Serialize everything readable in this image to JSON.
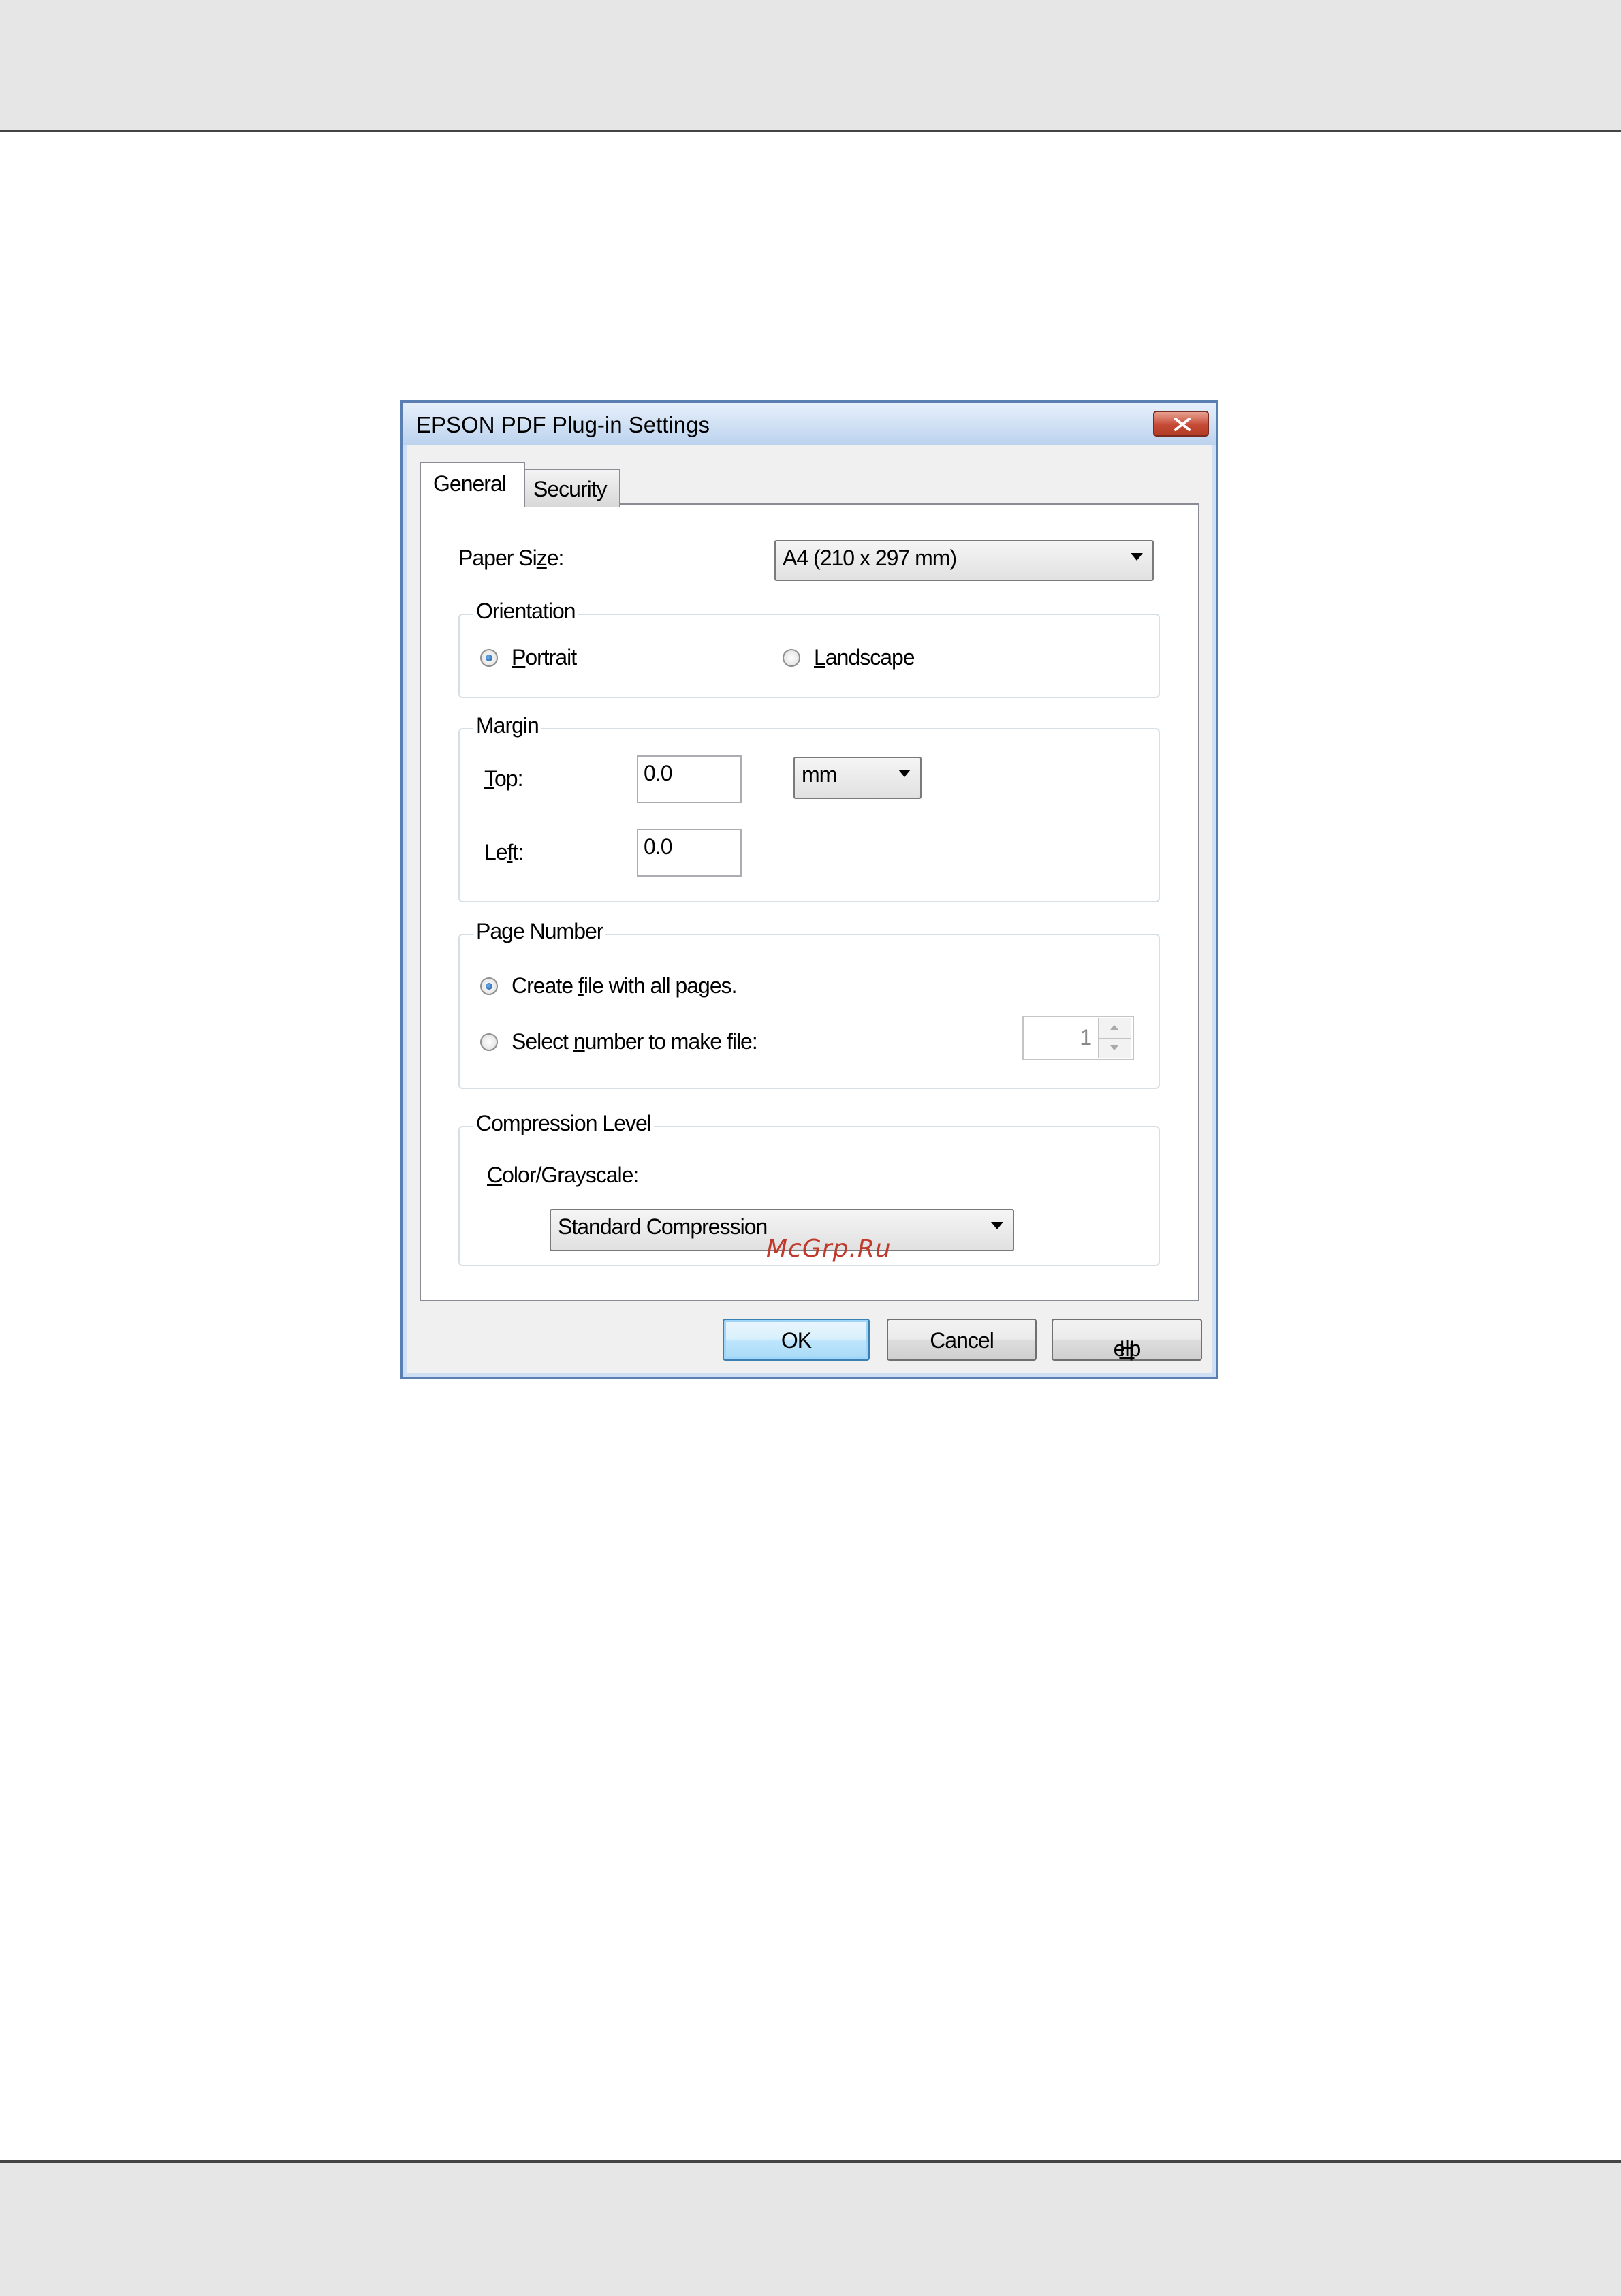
{
  "dialog": {
    "title": "EPSON PDF Plug-in Settings",
    "tabs": [
      {
        "label": "General",
        "selected": true
      },
      {
        "label": "Security",
        "selected": false
      }
    ],
    "paper_size": {
      "label_pre": "Paper Si",
      "label_key": "z",
      "label_post": "e:",
      "value": "A4 (210 x 297 mm)"
    },
    "orientation": {
      "legend": "Orientation",
      "portrait": {
        "key": "P",
        "rest": "ortrait",
        "selected": true
      },
      "landscape": {
        "key": "L",
        "rest": "andscape",
        "selected": false
      }
    },
    "margin": {
      "legend": "Margin",
      "top_label_key": "T",
      "top_label_rest": "op:",
      "top_value": "0.0",
      "left_label_pre": "Le",
      "left_label_key": "f",
      "left_label_post": "t:",
      "left_value": "0.0",
      "unit": "mm"
    },
    "page_number": {
      "legend": "Page Number",
      "all_pages": {
        "pre": "Create ",
        "key": "f",
        "post": "ile with all pages.",
        "selected": true
      },
      "select_number": {
        "pre": "Select ",
        "key": "n",
        "post": "umber to make file:",
        "selected": false
      },
      "spin_value": "1"
    },
    "compression": {
      "legend": "Compression Level",
      "color_label_key": "C",
      "color_label_rest": "olor/Grayscale:",
      "value": "Standard Compression"
    },
    "watermark": "McGrp.Ru",
    "buttons": {
      "ok": "OK",
      "cancel": "Cancel",
      "help_key": "H",
      "help_rest": "elp"
    }
  }
}
